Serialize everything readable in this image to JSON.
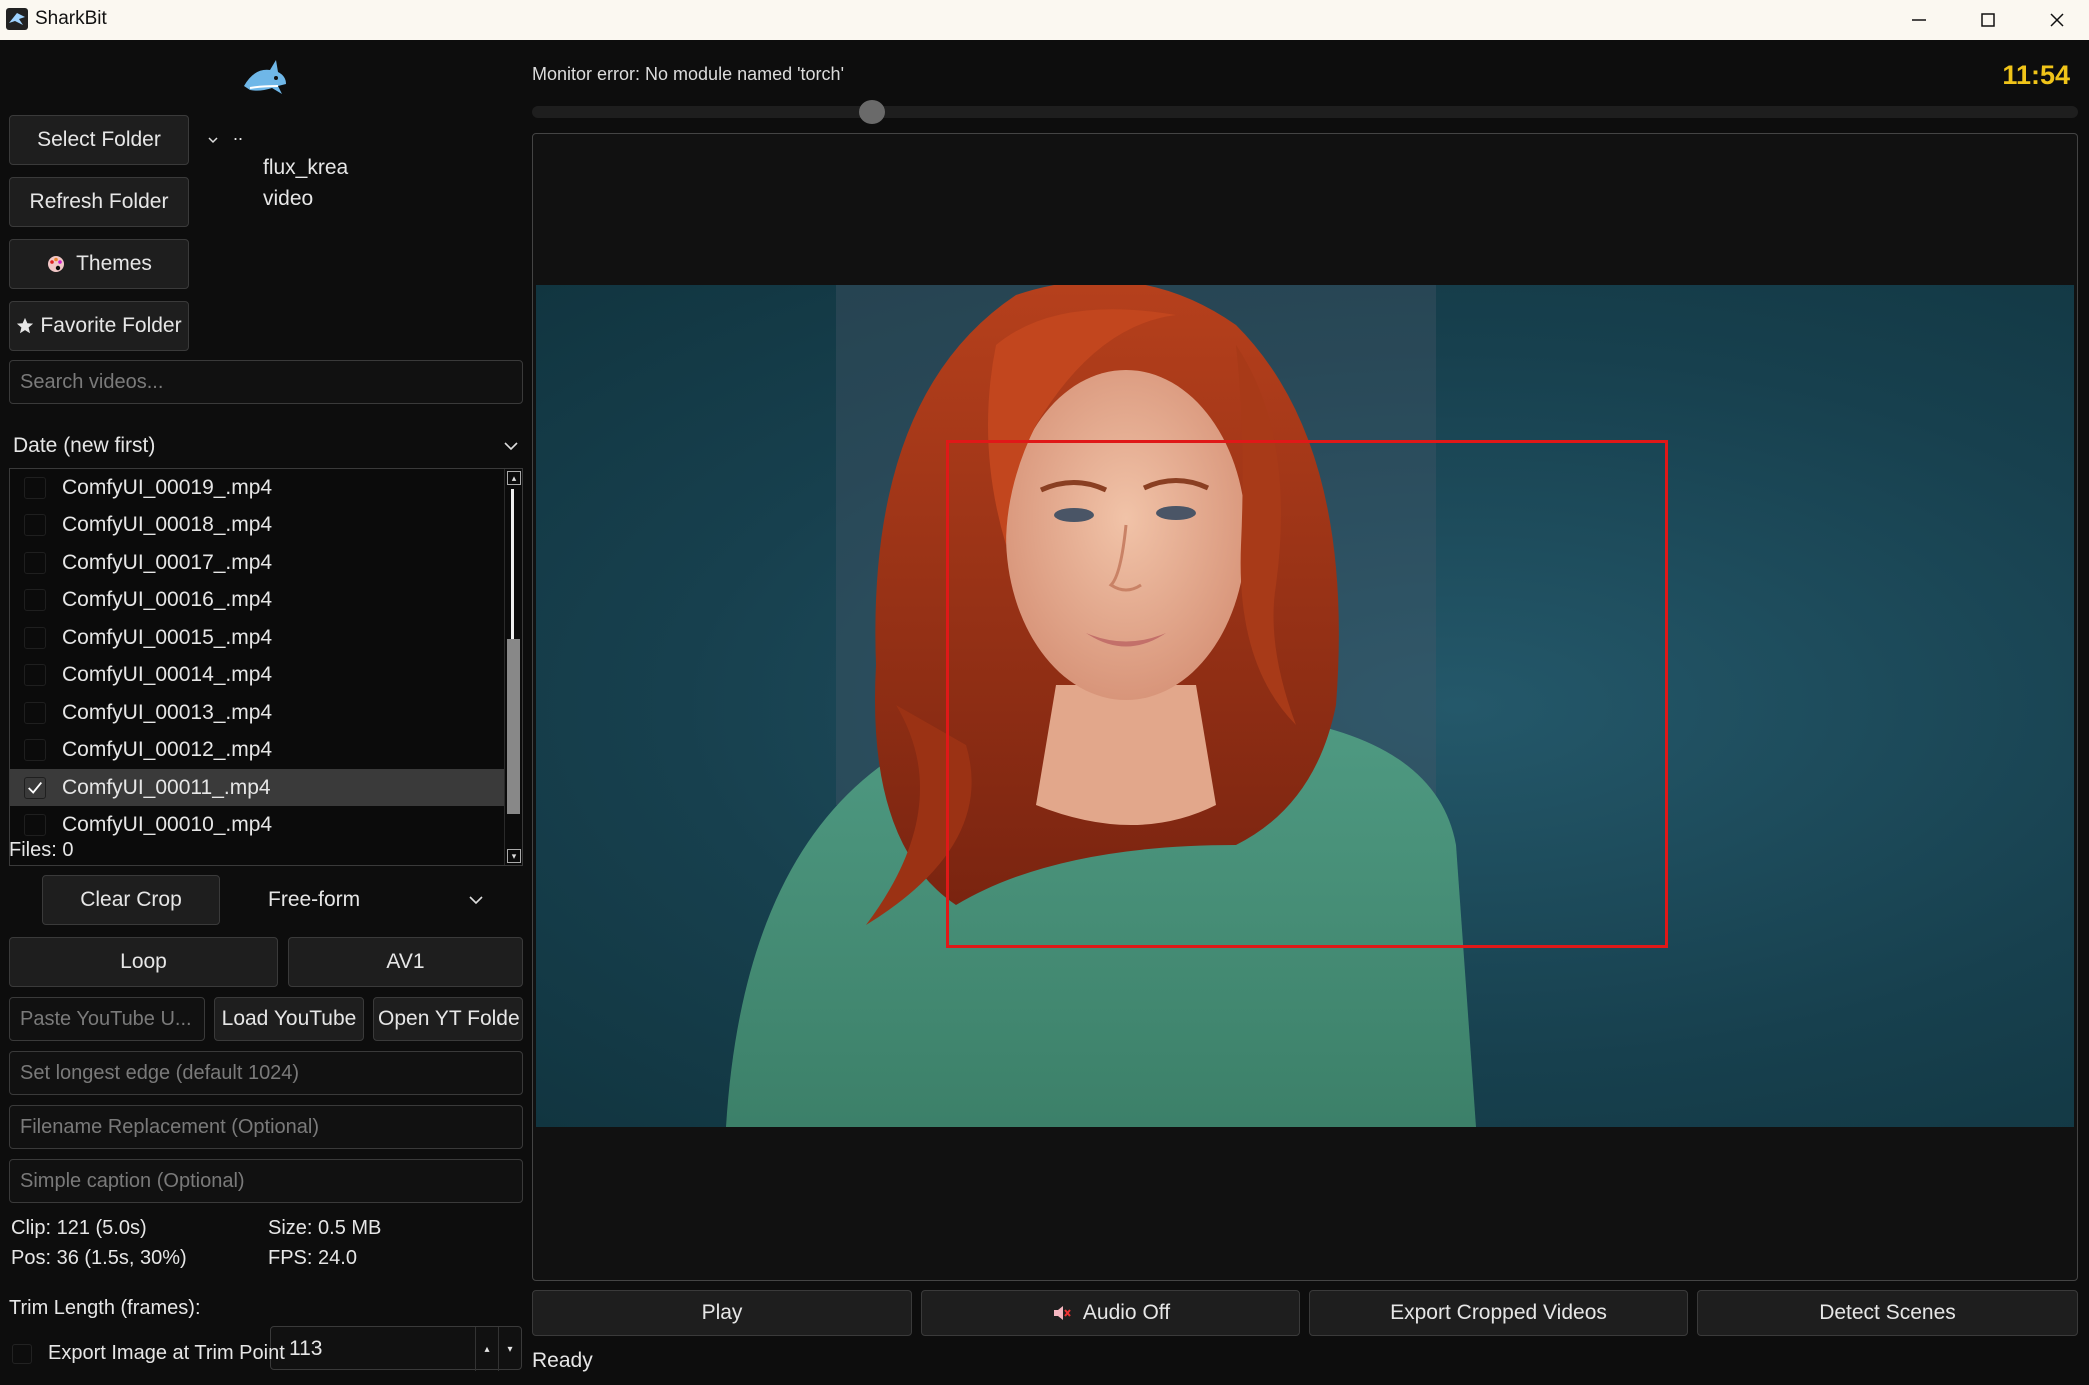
{
  "window": {
    "title": "SharkBit"
  },
  "sidebar": {
    "select_folder": "Select Folder",
    "refresh_folder": "Refresh Folder",
    "themes": "Themes",
    "favorite_folder": "Favorite Folder",
    "tree": {
      "parent": "..",
      "folders": [
        "flux_krea",
        "video"
      ]
    },
    "search_placeholder": "Search videos...",
    "sort_value": "Date (new first)",
    "files": [
      {
        "name": "ComfyUI_00019_.mp4",
        "checked": false
      },
      {
        "name": "ComfyUI_00018_.mp4",
        "checked": false
      },
      {
        "name": "ComfyUI_00017_.mp4",
        "checked": false
      },
      {
        "name": "ComfyUI_00016_.mp4",
        "checked": false
      },
      {
        "name": "ComfyUI_00015_.mp4",
        "checked": false
      },
      {
        "name": "ComfyUI_00014_.mp4",
        "checked": false
      },
      {
        "name": "ComfyUI_00013_.mp4",
        "checked": false
      },
      {
        "name": "ComfyUI_00012_.mp4",
        "checked": false
      },
      {
        "name": "ComfyUI_00011_.mp4",
        "checked": true
      },
      {
        "name": "ComfyUI_00010_.mp4",
        "checked": false
      }
    ],
    "files_count": "Files: 0",
    "clear_crop": "Clear Crop",
    "aspect_value": "Free-form",
    "loop": "Loop",
    "codec": "AV1",
    "youtube_placeholder": "Paste YouTube U...",
    "load_youtube": "Load YouTube",
    "open_yt_folder": "Open YT Folde",
    "longest_edge_placeholder": "Set longest edge (default 1024)",
    "filename_placeholder": "Filename Replacement (Optional)",
    "caption_placeholder": "Simple caption (Optional)",
    "clip_info": "Clip: 121 (5.0s)",
    "size_info": "Size: 0.5 MB",
    "pos_info": "Pos: 36 (1.5s, 30%)",
    "fps_info": "FPS: 24.0",
    "trim_label": "Trim Length (frames):",
    "trim_value": "113",
    "export_image_label": "Export Image at Trim Point"
  },
  "main": {
    "monitor_error": "Monitor error: No module named 'torch'",
    "clock": "11:54",
    "timeline_position_pct": 22,
    "play": "Play",
    "audio": "Audio Off",
    "export": "Export Cropped Videos",
    "detect": "Detect Scenes",
    "status": "Ready"
  },
  "colors": {
    "accent_clock": "#f0c419",
    "crop_box": "#e01818"
  }
}
